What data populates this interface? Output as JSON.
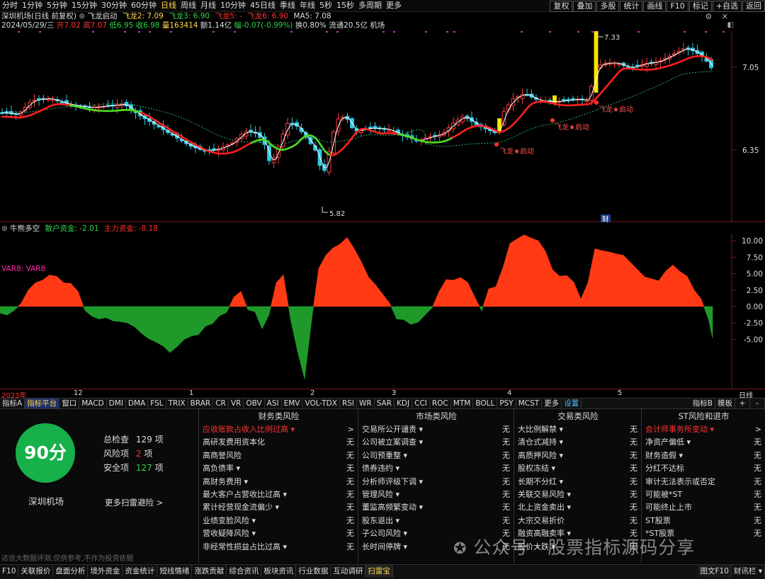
{
  "toolbar": {
    "periods": [
      "分时",
      "1分钟",
      "5分钟",
      "15分钟",
      "30分钟",
      "60分钟",
      "日线",
      "周线",
      "月线",
      "10分钟",
      "45日线",
      "季线",
      "年线",
      "5秒",
      "15秒",
      "多周期",
      "更多"
    ],
    "active_period": "日线",
    "right_buttons": [
      "复权",
      "叠加",
      "多股",
      "统计",
      "画线",
      "F10",
      "标记",
      "+自选",
      "返回"
    ]
  },
  "header": {
    "stock_title": "深圳机场(日线 前复权)",
    "indicator_name": "飞龙启动",
    "fl2": "飞龙2: 7.09",
    "fl3": "飞龙3: 6.90",
    "fl5": "飞龙5: -",
    "fl6": "飞龙6: 6.90",
    "ma5": "MA5: 7.08"
  },
  "quote": {
    "date": "2024/05/29/三",
    "open": "开7.02",
    "high": "高7.07",
    "low": "低6.95",
    "close": "收6.98",
    "volume": "量163414",
    "amount": "额1.14亿",
    "change": "幅-0.07(-0.99%)",
    "turnover": "换0.80%",
    "float_cap": "流通20.5亿",
    "board": "机场"
  },
  "price_axis": [
    "7.05",
    "6.35"
  ],
  "annotations": {
    "high_price": "7.33",
    "low_price": "5.82",
    "signal": "飞龙★启动",
    "fin_marker": "财"
  },
  "lower": {
    "name": "牛熊多空",
    "retail": "散户资金: -2.01",
    "main": "主力资金: -8.18",
    "var_label": "VAR8: VAR8"
  },
  "chart_data": {
    "type": "area",
    "title": "牛熊多空",
    "ylim": [
      -12.5,
      12.5
    ],
    "yticks": [
      "10.00",
      "7.50",
      "5.00",
      "2.50",
      "0.00",
      "-2.50",
      "-5.00"
    ],
    "x": [
      0,
      10,
      20,
      30,
      40,
      50,
      60,
      70,
      80,
      90,
      100,
      110,
      120,
      130,
      140,
      150,
      160,
      170,
      180,
      190,
      200,
      210,
      220,
      230,
      240,
      250,
      260,
      270,
      280,
      290,
      300,
      310,
      320,
      330,
      340,
      350,
      360,
      370,
      380,
      390,
      400,
      410,
      420,
      430,
      440,
      450,
      460,
      470,
      480,
      490,
      500,
      510,
      520,
      530,
      540,
      550,
      560,
      570,
      580,
      590,
      600,
      610,
      620,
      630,
      640,
      650,
      660,
      670,
      680,
      690,
      700,
      710,
      720,
      730,
      740,
      750,
      760,
      770,
      780,
      790,
      800,
      810,
      820,
      830,
      840,
      850,
      860,
      870,
      880,
      890,
      900,
      910,
      920,
      930,
      940,
      950,
      960,
      970,
      980,
      990,
      1000,
      1006
    ],
    "values": [
      -1.0,
      -1.3,
      -0.6,
      0.5,
      2.5,
      3.6,
      4.0,
      4.8,
      4.6,
      3.6,
      3.5,
      2.3,
      -0.6,
      -1.5,
      -1.9,
      -1.7,
      -2.2,
      -2.3,
      -2.5,
      -3.1,
      -4.1,
      -4.9,
      -5.4,
      -6.0,
      -7.0,
      -6.1,
      -5.0,
      -4.5,
      -4.3,
      -3.0,
      -2.6,
      -1.4,
      -0.9,
      1.4,
      2.3,
      -0.5,
      -0.8,
      -3.4,
      -1.2,
      3.6,
      4.8,
      -1.8,
      -6.8,
      -11.0,
      -2.0,
      5.8,
      7.8,
      8.9,
      9.5,
      10.5,
      8.8,
      6.8,
      4.5,
      3.3,
      1.9,
      0.5,
      -1.9,
      -2.0,
      -2.7,
      -2.4,
      -1.3,
      -0.2,
      2.3,
      4.1,
      4.0,
      4.4,
      3.7,
      1.5,
      -0.7,
      2.7,
      3.0,
      5.9,
      9.6,
      10.3,
      10.9,
      10.4,
      10.0,
      8.4,
      5.6,
      4.6,
      4.7,
      3.7,
      1.1,
      3.6,
      8.8,
      8.5,
      8.3,
      8.0,
      7.8,
      6.7,
      5.6,
      4.5,
      4.2,
      3.9,
      5.4,
      6.3,
      5.3,
      4.6,
      2.5,
      1.1,
      -1.9,
      -4.8
    ],
    "colors": {
      "positive": "#ff3a14",
      "negative": "#1f9a2a"
    }
  },
  "x_axis": [
    "2023年",
    "12",
    "1",
    "2",
    "3",
    "4",
    "5",
    "日线"
  ],
  "indicator_tabs": [
    "指标A",
    "指标平台",
    "窗口",
    "MACD",
    "DMI",
    "DMA",
    "FSL",
    "TRIX",
    "BRAR",
    "CR",
    "VR",
    "OBV",
    "ASI",
    "EMV",
    "VOL-TDX",
    "RSI",
    "WR",
    "SAR",
    "KDJ",
    "CCI",
    "ROC",
    "MTM",
    "BOLL",
    "PSY",
    "MCST",
    "更多",
    "设置"
  ],
  "indicator_right": [
    "指标B",
    "模板"
  ],
  "scan": {
    "score": "90分",
    "stock": "深圳机场",
    "total_label": "总检查",
    "total": "129",
    "total_unit": "项",
    "risk_label": "风险项",
    "risk": "2",
    "risk_unit": "项",
    "safe_label": "安全项",
    "safe": "127",
    "safe_unit": "项",
    "more": "更多扫雷避险 >",
    "disclaimer": "达信大数据评测,仅供参考,不作为投资依据"
  },
  "risk_columns": [
    {
      "title": "财务类风险",
      "items": [
        {
          "label": "应收账款占收入比例过高 ▾",
          "status": ">",
          "warn": true
        },
        {
          "label": "高研发费用资本化",
          "status": "无"
        },
        {
          "label": "高商誉风险",
          "status": "无"
        },
        {
          "label": "高负债率 ▾",
          "status": "无"
        },
        {
          "label": "高财务费用 ▾",
          "status": "无"
        },
        {
          "label": "最大客户占营收比过高 ▾",
          "status": "无"
        },
        {
          "label": "累计经营现金流偏少 ▾",
          "status": "无"
        },
        {
          "label": "业绩变脸风险 ▾",
          "status": "无"
        },
        {
          "label": "营收疑降风险 ▾",
          "status": "无"
        },
        {
          "label": "非经常性损益占比过高 ▾",
          "status": "无"
        }
      ]
    },
    {
      "title": "市场类风险",
      "items": [
        {
          "label": "交易所公开谴责 ▾",
          "status": "无"
        },
        {
          "label": "公司被立案调查 ▾",
          "status": "无"
        },
        {
          "label": "公司预重整 ▾",
          "status": "无"
        },
        {
          "label": "债券违约 ▾",
          "status": "无"
        },
        {
          "label": "分析师评级下调 ▾",
          "status": "无"
        },
        {
          "label": "管理风险 ▾",
          "status": "无"
        },
        {
          "label": "董监高频繁变动 ▾",
          "status": "无"
        },
        {
          "label": "股东退出 ▾",
          "status": "无"
        },
        {
          "label": "子公司风险 ▾",
          "status": "无"
        },
        {
          "label": "长时间停牌 ▾",
          "status": "无"
        }
      ]
    },
    {
      "title": "交易类风险",
      "items": [
        {
          "label": "大比例解禁 ▾",
          "status": "无"
        },
        {
          "label": "清仓式减持 ▾",
          "status": "无"
        },
        {
          "label": "高质押风险 ▾",
          "status": "无"
        },
        {
          "label": "股权冻结 ▾",
          "status": "无"
        },
        {
          "label": "长期不分红 ▾",
          "status": "无"
        },
        {
          "label": "关联交易风险 ▾",
          "status": "无"
        },
        {
          "label": "北上资金卖出 ▾",
          "status": "无"
        },
        {
          "label": "大宗交易折价",
          "status": "无"
        },
        {
          "label": "融资高融卖率 ▾",
          "status": "无"
        },
        {
          "label": "股价大跌 ▾",
          "status": "无"
        }
      ]
    },
    {
      "title": "ST风险和退市",
      "items": [
        {
          "label": "会计师事务所变动 ▾",
          "status": ">",
          "warn": true
        },
        {
          "label": "净资产偏低 ▾",
          "status": "无"
        },
        {
          "label": "财务造假 ▾",
          "status": "无"
        },
        {
          "label": "分红不达标",
          "status": "无"
        },
        {
          "label": "审计无法表示或否定",
          "status": "无"
        },
        {
          "label": "可能被*ST",
          "status": "无"
        },
        {
          "label": "可能终止上市",
          "status": "无"
        },
        {
          "label": "ST股票",
          "status": "无"
        },
        {
          "label": "*ST股票",
          "status": "无"
        },
        {
          "label": "",
          "status": ""
        }
      ]
    }
  ],
  "bottom_tabs": [
    "F10",
    "关联报价",
    "盘面分析",
    "境外资金",
    "资金统计",
    "短线情绪",
    "涨跌贡献",
    "综合资讯",
    "板块资讯",
    "行业数据",
    "互动调研",
    "扫雷宝"
  ],
  "bottom_active": "扫雷宝",
  "bottom_right": [
    "图文F10",
    "财讯栏 ▾"
  ],
  "watermark": "公众号 · 股票指标源码分享"
}
